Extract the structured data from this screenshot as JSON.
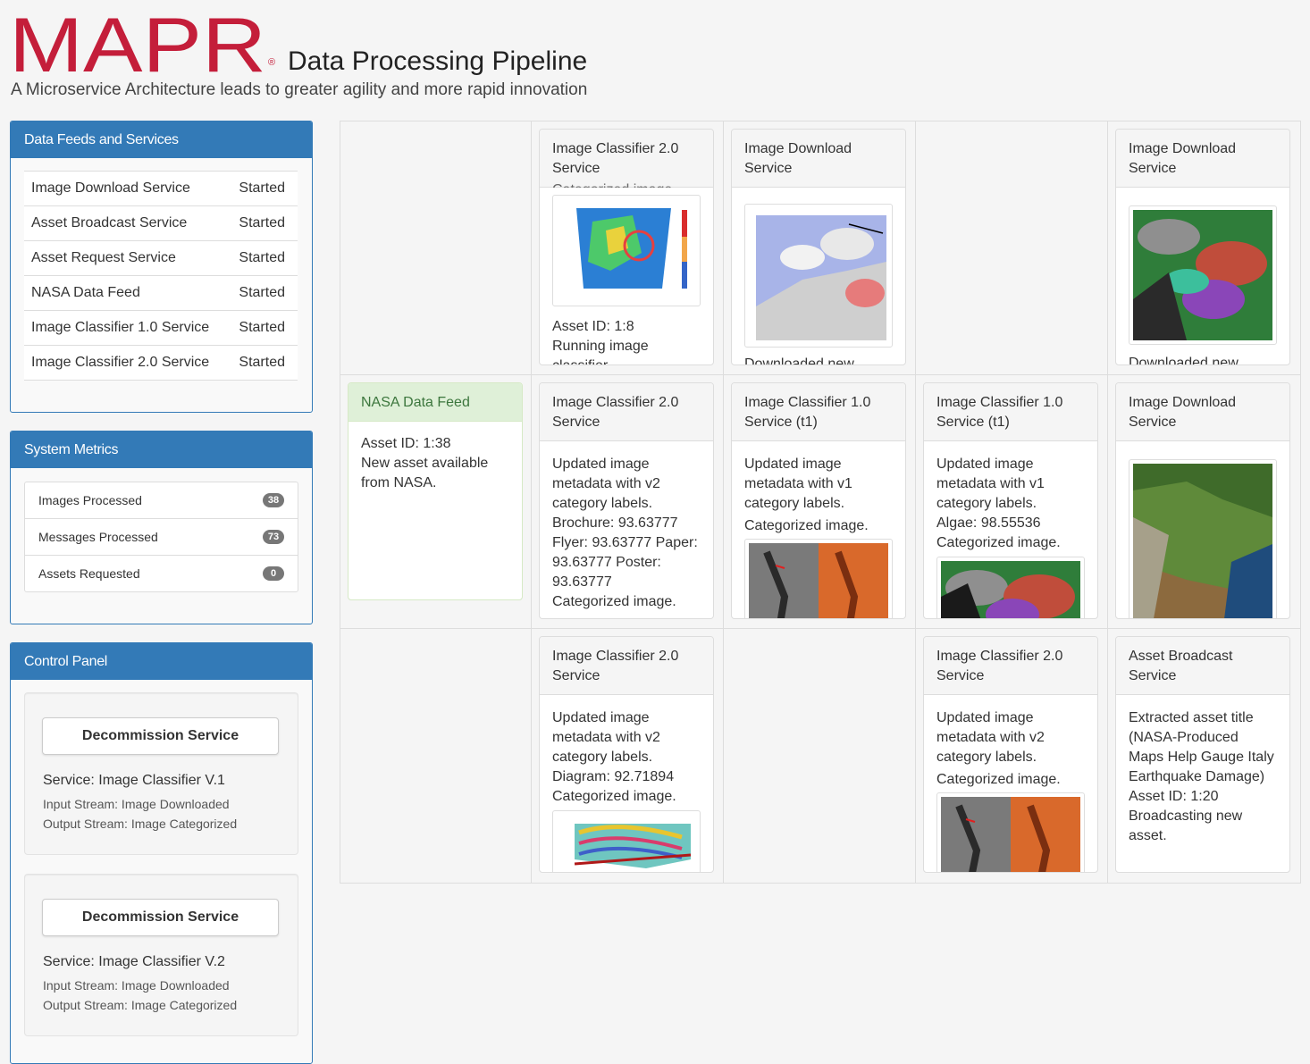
{
  "header": {
    "logo_text": "MAPR",
    "registered_mark": "®",
    "title": "Data Processing Pipeline",
    "tagline": "A Microservice Architecture leads to greater agility and more rapid innovation",
    "brand_color": "#c41e3a"
  },
  "feeds": {
    "heading": "Data Feeds and Services",
    "rows": [
      {
        "name": "Image Download Service",
        "status": "Started"
      },
      {
        "name": "Asset Broadcast Service",
        "status": "Started"
      },
      {
        "name": "Asset Request Service",
        "status": "Started"
      },
      {
        "name": "NASA Data Feed",
        "status": "Started"
      },
      {
        "name": "Image Classifier 1.0 Service",
        "status": "Started"
      },
      {
        "name": "Image Classifier 2.0 Service",
        "status": "Started"
      }
    ]
  },
  "metrics": {
    "heading": "System Metrics",
    "items": [
      {
        "label": "Images Processed",
        "count": "38"
      },
      {
        "label": "Messages Processed",
        "count": "73"
      },
      {
        "label": "Assets Requested",
        "count": "0"
      }
    ]
  },
  "control": {
    "heading": "Control Panel",
    "services": [
      {
        "button": "Decommission Service",
        "service": "Service: Image Classifier V.1",
        "input": "Input Stream: Image Downloaded",
        "output": "Output Stream: Image Categorized"
      },
      {
        "button": "Decommission Service",
        "service": "Service: Image Classifier V.2",
        "input": "Input Stream: Image Downloaded",
        "output": "Output Stream: Image Categorized"
      }
    ]
  },
  "pipeline": {
    "row1": [
      {
        "title": "Image Classifier 2.0 Service",
        "partial_top": "Categorized image.",
        "lines": [
          "Asset ID: 1:8",
          "Running image",
          "classifier"
        ],
        "image": "map-thumbnail"
      },
      {
        "title": "Image Download Service",
        "lines": [
          "Downloaded new"
        ],
        "image": "satellite-thumbnail"
      },
      {
        "title": "Image Download Service",
        "lines": [
          "Downloaded new"
        ],
        "image": "terrain-thumbnail"
      }
    ],
    "row2": [
      {
        "title": "NASA Data Feed",
        "lines": [
          "Asset ID: 1:38",
          "New asset available from NASA."
        ]
      },
      {
        "title": "Image Classifier 2.0 Service",
        "lines": [
          "Updated image metadata with v2 category labels.",
          "Brochure: 93.63777 Flyer: 93.63777 Paper: 93.63777 Poster: 93.63777",
          "Categorized image."
        ]
      },
      {
        "title": "Image Classifier 1.0 Service (t1)",
        "lines": [
          "Updated image metadata with v1 category labels.",
          "Categorized image."
        ],
        "image": "radar-thumbnail"
      },
      {
        "title": "Image Classifier 1.0 Service (t1)",
        "lines": [
          "Updated image metadata with v1 category labels.",
          "Algae: 98.55536",
          "Categorized image."
        ],
        "image": "terrain-thumbnail"
      },
      {
        "title": "Image Download Service",
        "lines": [],
        "image": "landscape-thumbnail"
      }
    ],
    "row3": [
      {
        "title": "Image Classifier 2.0 Service",
        "lines": [
          "Updated image metadata with v2 category labels.",
          "Diagram: 92.71894",
          "Categorized image."
        ],
        "image": "interferogram-thumbnail"
      },
      {
        "title": "Image Classifier 2.0 Service",
        "lines": [
          "Updated image metadata with v2 category labels.",
          "Categorized image."
        ],
        "image": "radar-thumbnail"
      },
      {
        "title": "Asset Broadcast Service",
        "lines": [
          "Extracted asset title (NASA-Produced Maps Help Gauge Italy Earthquake Damage)",
          "Asset ID: 1:20",
          "Broadcasting new asset."
        ]
      }
    ]
  }
}
